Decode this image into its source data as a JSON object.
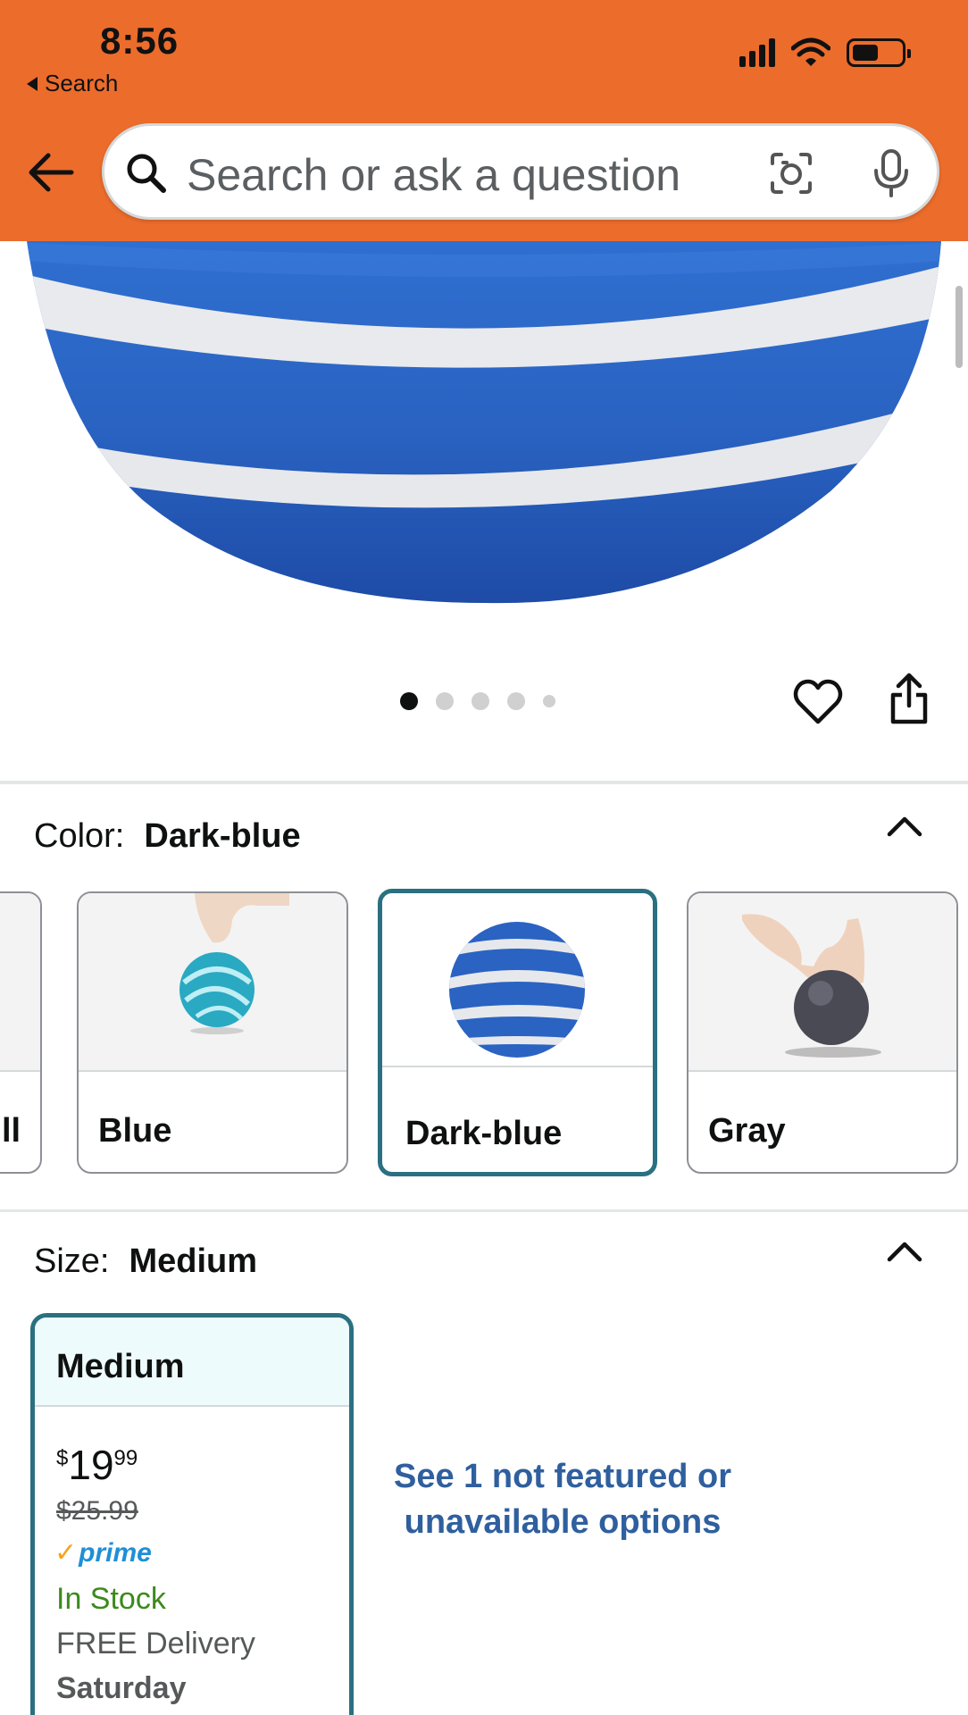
{
  "status_bar": {
    "time": "8:56",
    "back_label": "Search"
  },
  "search": {
    "placeholder": "Search or ask a question"
  },
  "carousel": {
    "dot_count": 5,
    "active_index": 0
  },
  "color": {
    "label": "Color:",
    "selected": "Dark-blue",
    "options": [
      {
        "label": "ll",
        "selected": false
      },
      {
        "label": "Blue",
        "selected": false
      },
      {
        "label": "Dark-blue",
        "selected": true
      },
      {
        "label": "Gray",
        "selected": false
      }
    ]
  },
  "size": {
    "label": "Size:",
    "selected": "Medium",
    "card": {
      "name": "Medium",
      "currency": "$",
      "price_whole": "19",
      "price_fraction": "99",
      "list_price": "$25.99",
      "prime_label": "prime",
      "stock": "In Stock",
      "delivery": "FREE Delivery",
      "delivery_day": "Saturday"
    },
    "unavailable_link": "See 1 not featured or unavailable options"
  },
  "colors": {
    "header": "#ec6c2c",
    "selected_border": "#2a7081",
    "link": "#2f5f9e",
    "in_stock": "#3c8a1c",
    "prime": "#1f8fd6"
  }
}
